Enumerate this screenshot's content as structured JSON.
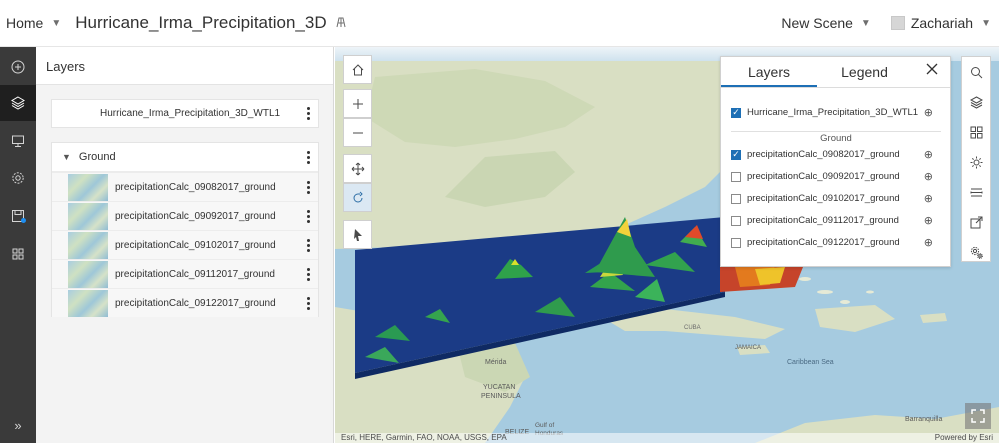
{
  "header": {
    "home_label": "Home",
    "scene_title": "Hurricane_Irma_Precipitation_3D",
    "new_scene_label": "New Scene",
    "user_name": "Zachariah"
  },
  "layers_panel": {
    "title": "Layers",
    "top_layer": "Hurricane_Irma_Precipitation_3D_WTL1",
    "group": {
      "name": "Ground",
      "layers": [
        "precipitationCalc_09082017_ground",
        "precipitationCalc_09092017_ground",
        "precipitationCalc_09102017_ground",
        "precipitationCalc_09112017_ground",
        "precipitationCalc_09122017_ground"
      ]
    }
  },
  "layer_list": {
    "tab_layers": "Layers",
    "tab_legend": "Legend",
    "top_layer": {
      "label": "Hurricane_Irma_Precipitation_3D_WTL1",
      "checked": true
    },
    "group_label": "Ground",
    "items": [
      {
        "label": "precipitationCalc_09082017_ground",
        "checked": true
      },
      {
        "label": "precipitationCalc_09092017_ground",
        "checked": false
      },
      {
        "label": "precipitationCalc_09102017_ground",
        "checked": false
      },
      {
        "label": "precipitationCalc_09112017_ground",
        "checked": false
      },
      {
        "label": "precipitationCalc_09122017_ground",
        "checked": false
      }
    ]
  },
  "map_labels": {
    "cuba": "CUBA",
    "merida": "Mérida",
    "yucatan": "YUCATAN",
    "peninsula": "PENINSULA",
    "belize": "BELIZE",
    "gulf": "Gulf of",
    "honduras": "Honduras",
    "jamaica": "JAMAICA",
    "caribbean": "Caribbean Sea",
    "barranquilla": "Barranquilla",
    "attribution": "Esri, HERE, Garmin, FAO, NOAA, USGS, EPA",
    "powered": "Powered by Esri"
  },
  "colors": {
    "accent": "#1d6fb5",
    "iconbar": "#3a3a3a",
    "ocean": "#a6cbe0",
    "land": "#d8dfc6",
    "raster_base": "#1b3b86"
  }
}
